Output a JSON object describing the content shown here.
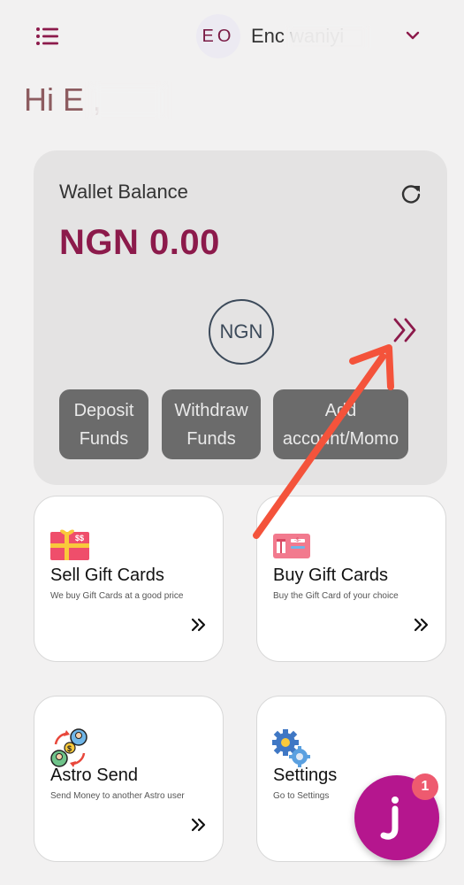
{
  "header": {
    "avatar_initials": "EO",
    "username": "Enc        waniyi"
  },
  "greeting": "Hi E     ,",
  "wallet": {
    "title": "Wallet Balance",
    "balance": "NGN 0.00",
    "currency_code": "NGN",
    "actions": [
      {
        "label": "Deposit Funds"
      },
      {
        "label": "Withdraw Funds"
      },
      {
        "label": "Add account/Momo"
      }
    ]
  },
  "tiles": [
    {
      "title": "Sell Gift Cards",
      "subtitle": "We buy Gift Cards at a good price",
      "icon": "gift-card-sell-icon"
    },
    {
      "title": "Buy Gift Cards",
      "subtitle": "Buy the Gift Card of your choice",
      "icon": "gift-card-buy-icon"
    },
    {
      "title": "Astro Send",
      "subtitle": "Send Money to another Astro user",
      "icon": "money-transfer-icon"
    },
    {
      "title": "Settings",
      "subtitle": "Go to Settings",
      "icon": "gears-icon"
    }
  ],
  "chat_fab": {
    "badge_count": "1"
  },
  "colors": {
    "brand": "#8c1a4b",
    "fab": "#b5168e",
    "button": "#6b6b6b",
    "annotation_arrow": "#f4533b"
  }
}
